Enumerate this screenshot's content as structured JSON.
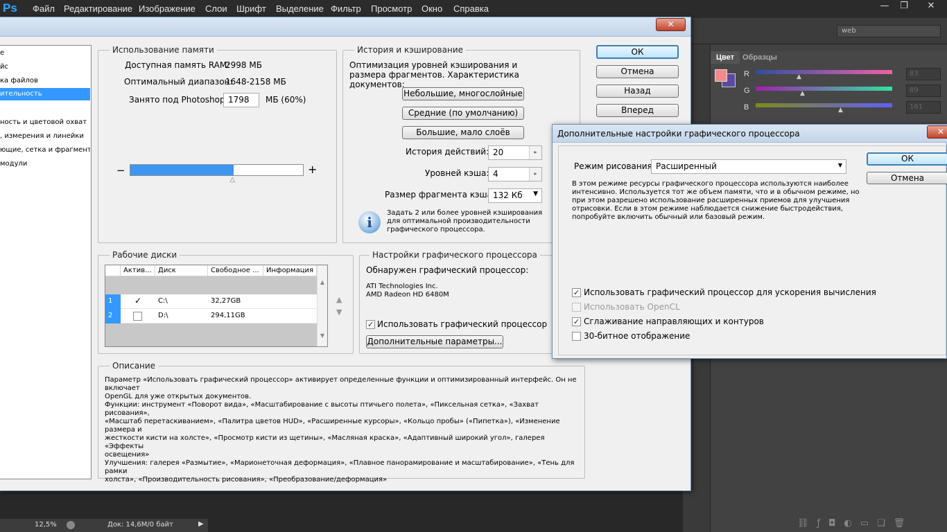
{
  "app": {
    "logo": "Ps",
    "menu": [
      "Файл",
      "Редактирование",
      "Изображение",
      "Слои",
      "Шрифт",
      "Выделение",
      "Фильтр",
      "Просмотр",
      "Окно",
      "Справка"
    ],
    "window_buttons": [
      "—",
      "❐",
      "✕"
    ],
    "workspace": "web"
  },
  "color_panel": {
    "tabs": [
      "Цвет",
      "Образцы"
    ],
    "sliders": [
      {
        "label": "R",
        "value": "83",
        "position": 0.33
      },
      {
        "label": "G",
        "value": "89",
        "position": 0.35
      },
      {
        "label": "B",
        "value": "161",
        "position": 0.63
      }
    ],
    "fg_color": "#f38989",
    "bg_color": "#5a4aa0"
  },
  "status": {
    "zoom": "12,5%",
    "doc": "Док: 14,6М/0 байт"
  },
  "prefs": {
    "categories": [
      "е",
      "йс",
      "ка файлов",
      "ительность",
      "",
      "ность и цветовой охват",
      ", измерения и линейки",
      "ющие, сетка и фрагменты",
      "модули"
    ],
    "selected_category": 3,
    "memory": {
      "title": "Использование памяти",
      "available_label": "Доступная память RAM:",
      "available_value": "2998 МБ",
      "range_label": "Оптимальный диапазон:",
      "range_value": "1648-2158 МБ",
      "used_label": "Занято под Photoshop:",
      "used_value": "1798",
      "used_unit": "МБ (60%)",
      "minus": "−",
      "plus": "+",
      "fraction": 0.6
    },
    "history": {
      "title": "История и кэширование",
      "desc": "Оптимизация уровней кэширования и размера фрагментов. Характеристика документов:",
      "presets": [
        "Небольшие, многослойные",
        "Средние (по умолчанию)",
        "Большие, мало слоёв"
      ],
      "history_label": "История действий:",
      "history_value": "20",
      "cache_label": "Уровней кэша:",
      "cache_value": "4",
      "tile_label": "Размер фрагмента кэша:",
      "tile_value": "132 Кб",
      "info": "Задать 2 или более уровней кэширования для оптимальной производительности графического процессора."
    },
    "scratch": {
      "title": "Рабочие диски",
      "headers": [
        "Актив...",
        "Диск",
        "Свободное ...",
        "Информация"
      ],
      "rows": [
        {
          "num": "1",
          "active": "✓",
          "disk": "C:\\",
          "free": "32,27GB",
          "info": ""
        },
        {
          "num": "2",
          "active": "",
          "disk": "D:\\",
          "free": "294,11GB",
          "info": ""
        }
      ],
      "up": "▲",
      "down": "▼"
    },
    "gpu": {
      "title": "Настройки графического процессора",
      "detected_label": "Обнаружен графический процессор:",
      "vendor": "ATI Technologies Inc.",
      "model": "AMD Radeon HD 6480M",
      "use_label": "Использовать графический процессор",
      "use_checked": "✓",
      "advanced_button": "Дополнительные параметры..."
    },
    "description": {
      "title": "Описание",
      "lines": [
        "Параметр «Использовать графический процессор» активирует определенные функции и оптимизированный интерфейс. Он не включает",
        "OpenGL для уже открытых документов.",
        "Функции: инструмент «Поворот вида», «Масштабирование с высоты птичьего полета», «Пиксельная сетка», «Захват рисования»,",
        "«Масштаб перетаскиванием», «Палитра цветов HUD», «Расширенные курсоры», «Кольцо пробы» («Пипетка»), «Изменение размера и",
        "жесткости кисти на холсте», «Просмотр кисти из щетины», «Масляная краска», «Адаптивный широкий угол», галерея «Эффекты",
        "освещения»",
        "Улучшения: галерея «Размытие», «Марионеточная деформация», «Плавное панорамирование и масштабирование», «Тень для рамки",
        "холста», «Производительность рисования», «Преобразование/деформация»"
      ]
    },
    "buttons": {
      "ok": "ОК",
      "cancel": "Отмена",
      "prev": "Назад",
      "next": "Вперед"
    },
    "close": "✕"
  },
  "gpu_dialog": {
    "title": "Дополнительные настройки графического процессора",
    "mode_label": "Режим рисования:",
    "mode_value": "Расширенный",
    "desc_lines": [
      "В этом режиме ресурсы графического процессора используются наиболее",
      "интенсивно.  Используется тот же объем памяти, что и в обычном режиме, но",
      "при этом разрешено использование расширенных приемов для улучшения",
      "отрисовки.  Если в этом режиме наблюдается снижение быстродействия,",
      "попробуйте включить обычный или базовый режим."
    ],
    "options": [
      {
        "label": "Использовать графический процессор для ускорения вычисления",
        "check": "✓",
        "disabled": false
      },
      {
        "label": "Использовать OpenCL",
        "check": "",
        "disabled": true
      },
      {
        "label": "Сглаживание направляющих и контуров",
        "check": "✓",
        "disabled": false
      },
      {
        "label": "30-битное отображение",
        "check": "",
        "disabled": false
      }
    ],
    "ok": "ОК",
    "cancel": "Отмена",
    "close": "✕"
  }
}
